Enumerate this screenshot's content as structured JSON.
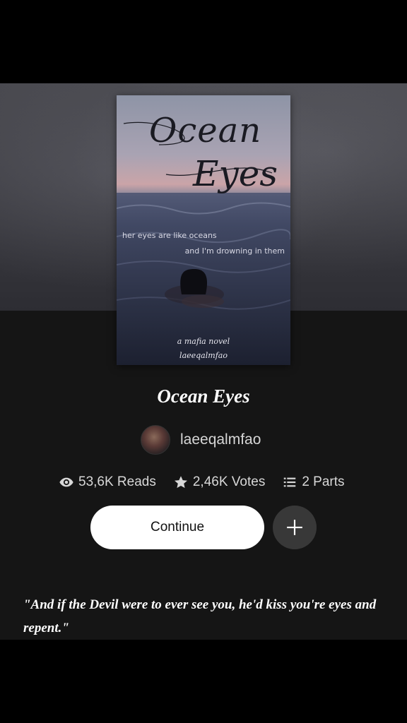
{
  "cover": {
    "title_line_1": "Ocean",
    "title_line_2": "Eyes",
    "tagline_1": "her eyes are like oceans",
    "tagline_2": "and I'm drowning in them",
    "subtitle": "a mafia novel",
    "author": "laeeqalmfao"
  },
  "story": {
    "title": "Ocean Eyes",
    "author": "laeeqalmfao"
  },
  "stats": {
    "reads": "53,6K Reads",
    "votes": "2,46K Votes",
    "parts": "2 Parts"
  },
  "actions": {
    "continue_label": "Continue"
  },
  "description": "\"And if the Devil were to ever see you, he'd kiss you're eyes and repent.\"",
  "icons": {
    "reads": "eye-icon",
    "votes": "star-icon",
    "parts": "list-icon",
    "add": "plus-icon"
  },
  "colors": {
    "background": "#151515",
    "button": "#ffffff",
    "add_button": "#383838",
    "text": "#ffffff"
  }
}
